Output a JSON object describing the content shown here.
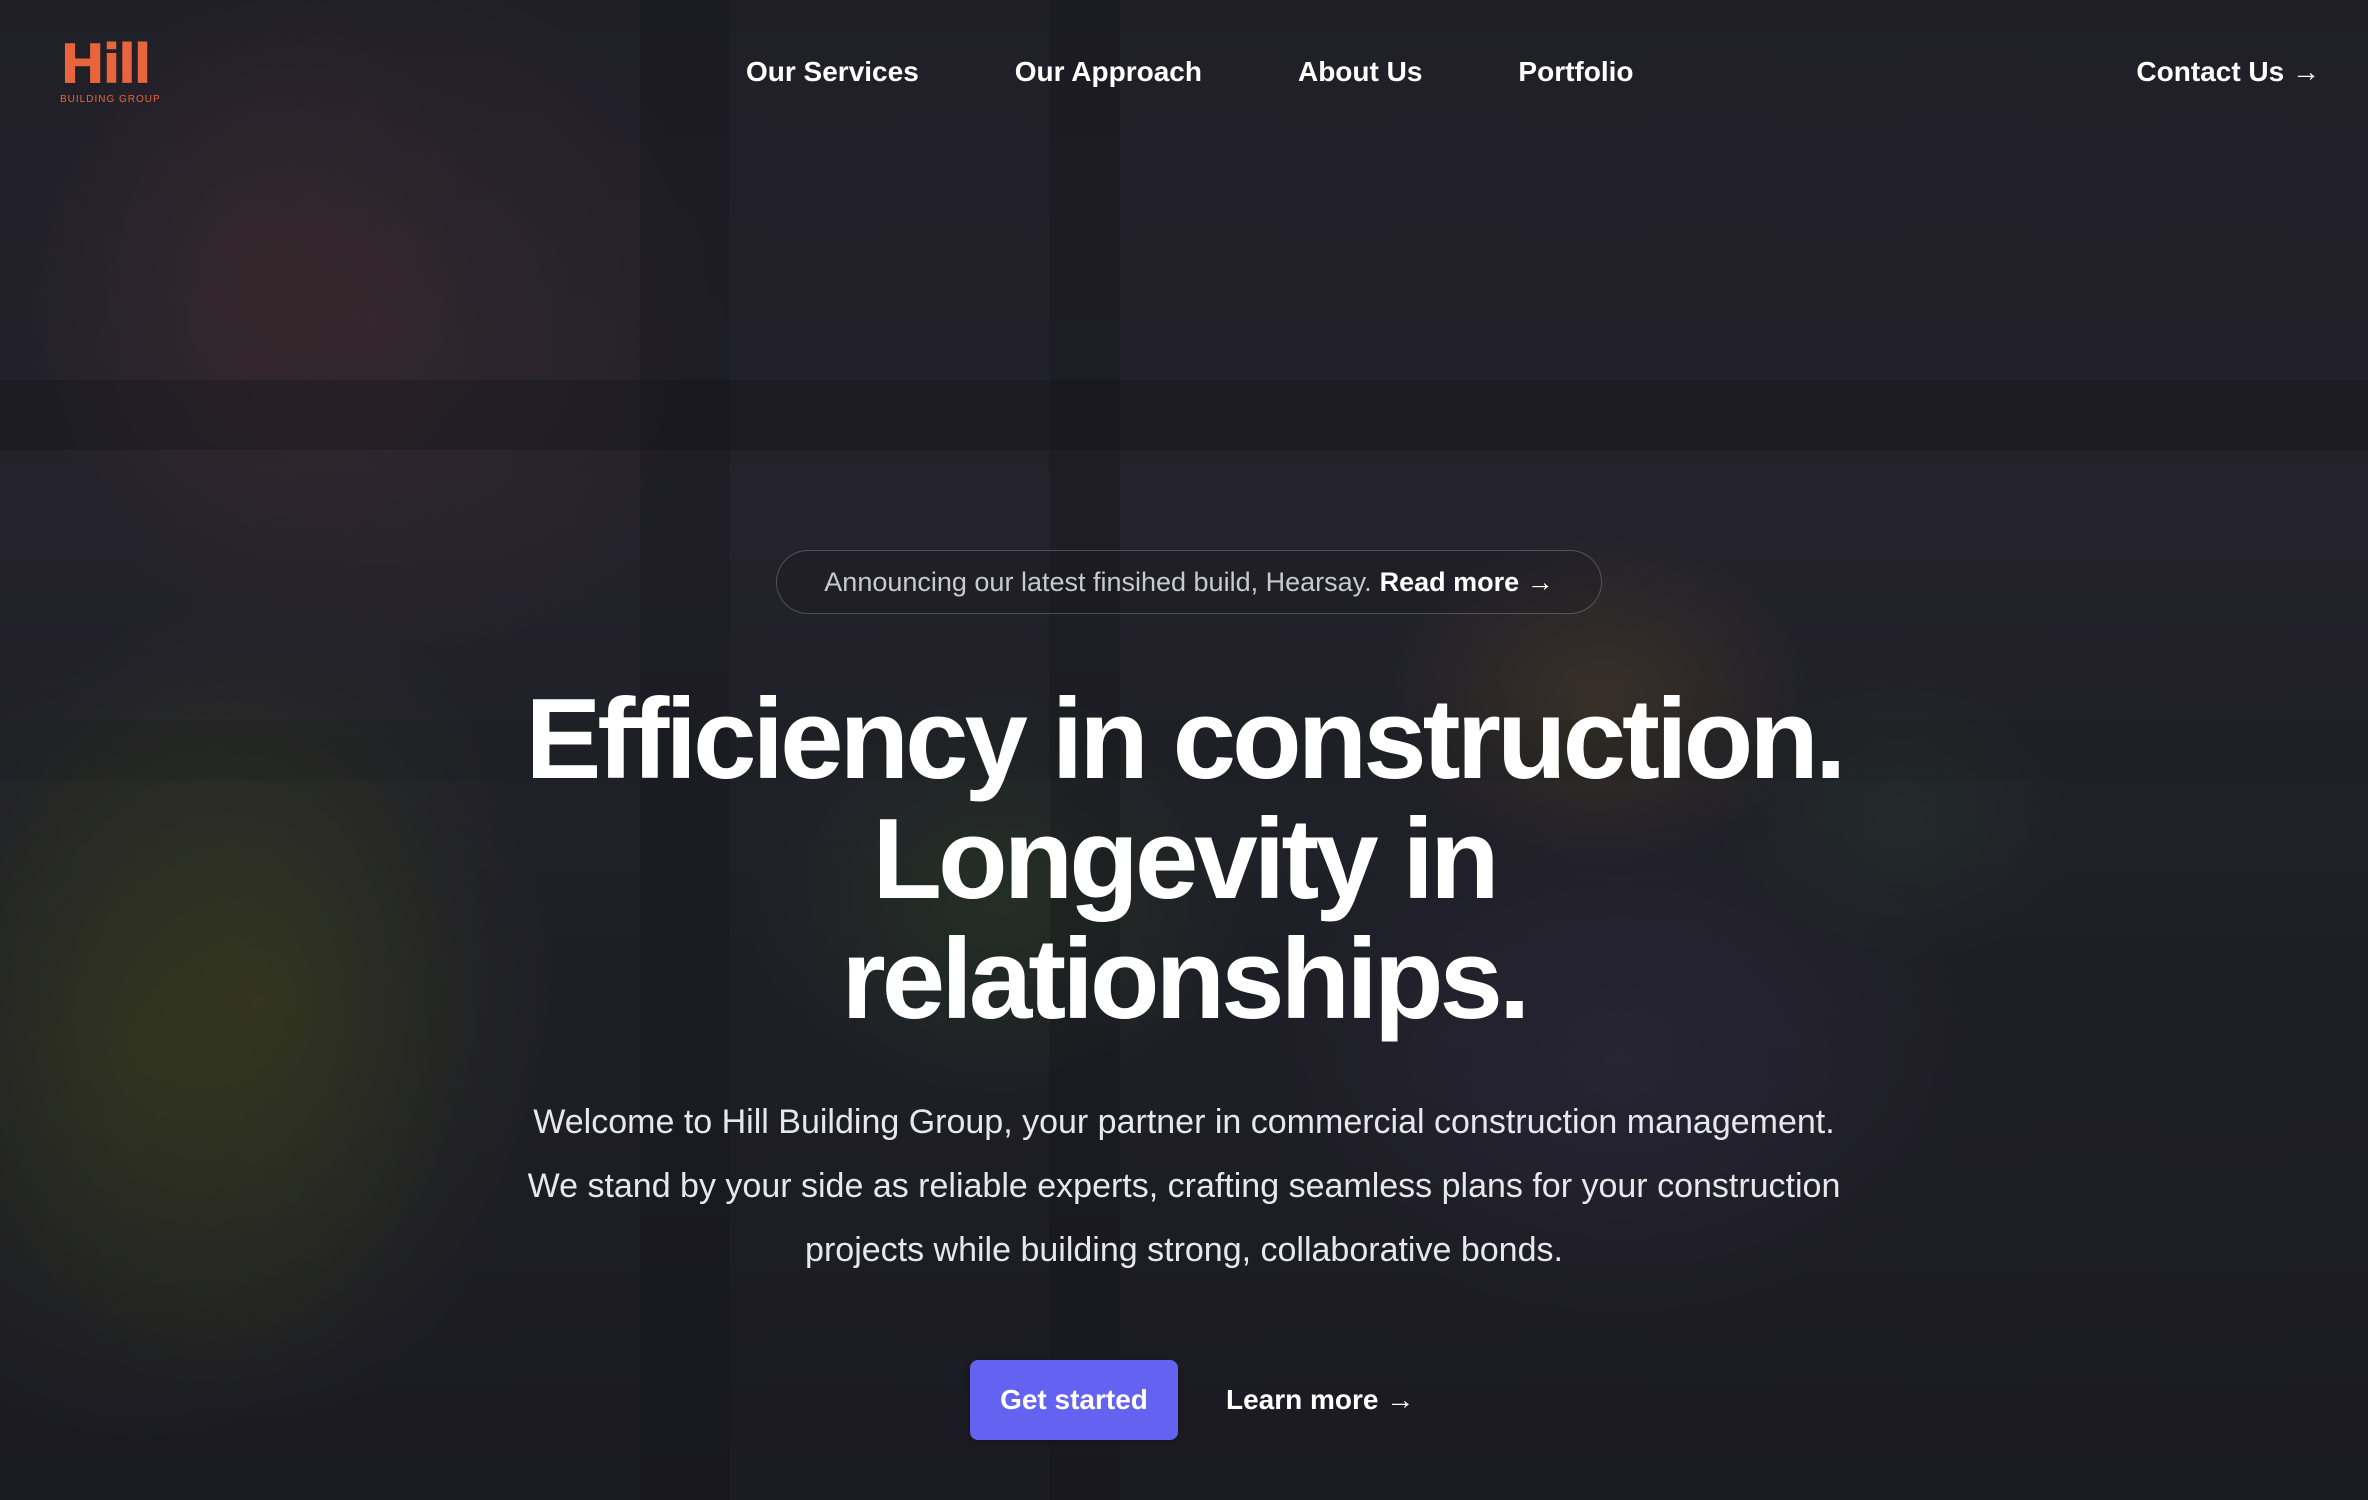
{
  "brand": {
    "logo_text": "Hill",
    "logo_subtext": "BUILDING GROUP",
    "accent_color": "#e8643c"
  },
  "nav": {
    "items": [
      {
        "label": "Our Services"
      },
      {
        "label": "Our Approach"
      },
      {
        "label": "About Us"
      },
      {
        "label": "Portfolio"
      }
    ],
    "contact_label": "Contact Us →"
  },
  "hero": {
    "announcement": {
      "text": "Announcing our latest finsihed build, Hearsay.",
      "link_label": "Read more →"
    },
    "headline_lines": [
      "Efficiency in construction.",
      "Longevity in",
      "relationships."
    ],
    "lede": "Welcome to Hill Building Group, your partner in commercial construction management. We stand by your side as reliable experts, crafting seamless plans for your construction projects while building strong, collaborative bonds.",
    "primary_cta": "Get started",
    "secondary_cta": "Learn more →",
    "primary_color": "#6462f1"
  }
}
